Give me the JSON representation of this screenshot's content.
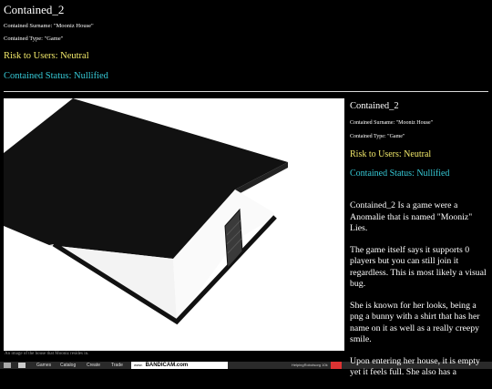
{
  "header": {
    "title": "Contained_2",
    "surname": "Contained Surname: \"Mooniz House\"",
    "type": "Contained Type: \"Game\"",
    "risk": "Risk to Users: Neutral",
    "status": "Contained Status: Nullified"
  },
  "image": {
    "caption": "An image of the house that Mooniz resides in."
  },
  "panel": {
    "title": "Contained_2",
    "surname": "Contained Surname: \"Mooniz House\"",
    "type": "Contained Type: \"Game\"",
    "risk": "Risk to Users: Neutral",
    "status": "Contained Status: Nullified",
    "paragraphs": [
      "Contained_2 Is a game were a Anomalie that is named \"Mooniz\" Lies.",
      "The game itself says it supports 0 players but you can still join it regardless. This is most likely a visual bug.",
      "She is known for her looks, being a png a bunny with a shirt that has her name on it as well as a really creepy smile.",
      "Upon entering her house, it is empty yet it feels full. She also has a"
    ]
  },
  "taskbar": {
    "items": [
      "Games",
      "Catalog",
      "Create",
      "Trade"
    ],
    "bandicam_small": "www.",
    "bandicam_label": "BANDICAM.com",
    "right_text": "HelpingRobotsorg 10k"
  },
  "colors": {
    "risk": "#f2e96a",
    "status": "#36c9d6"
  }
}
